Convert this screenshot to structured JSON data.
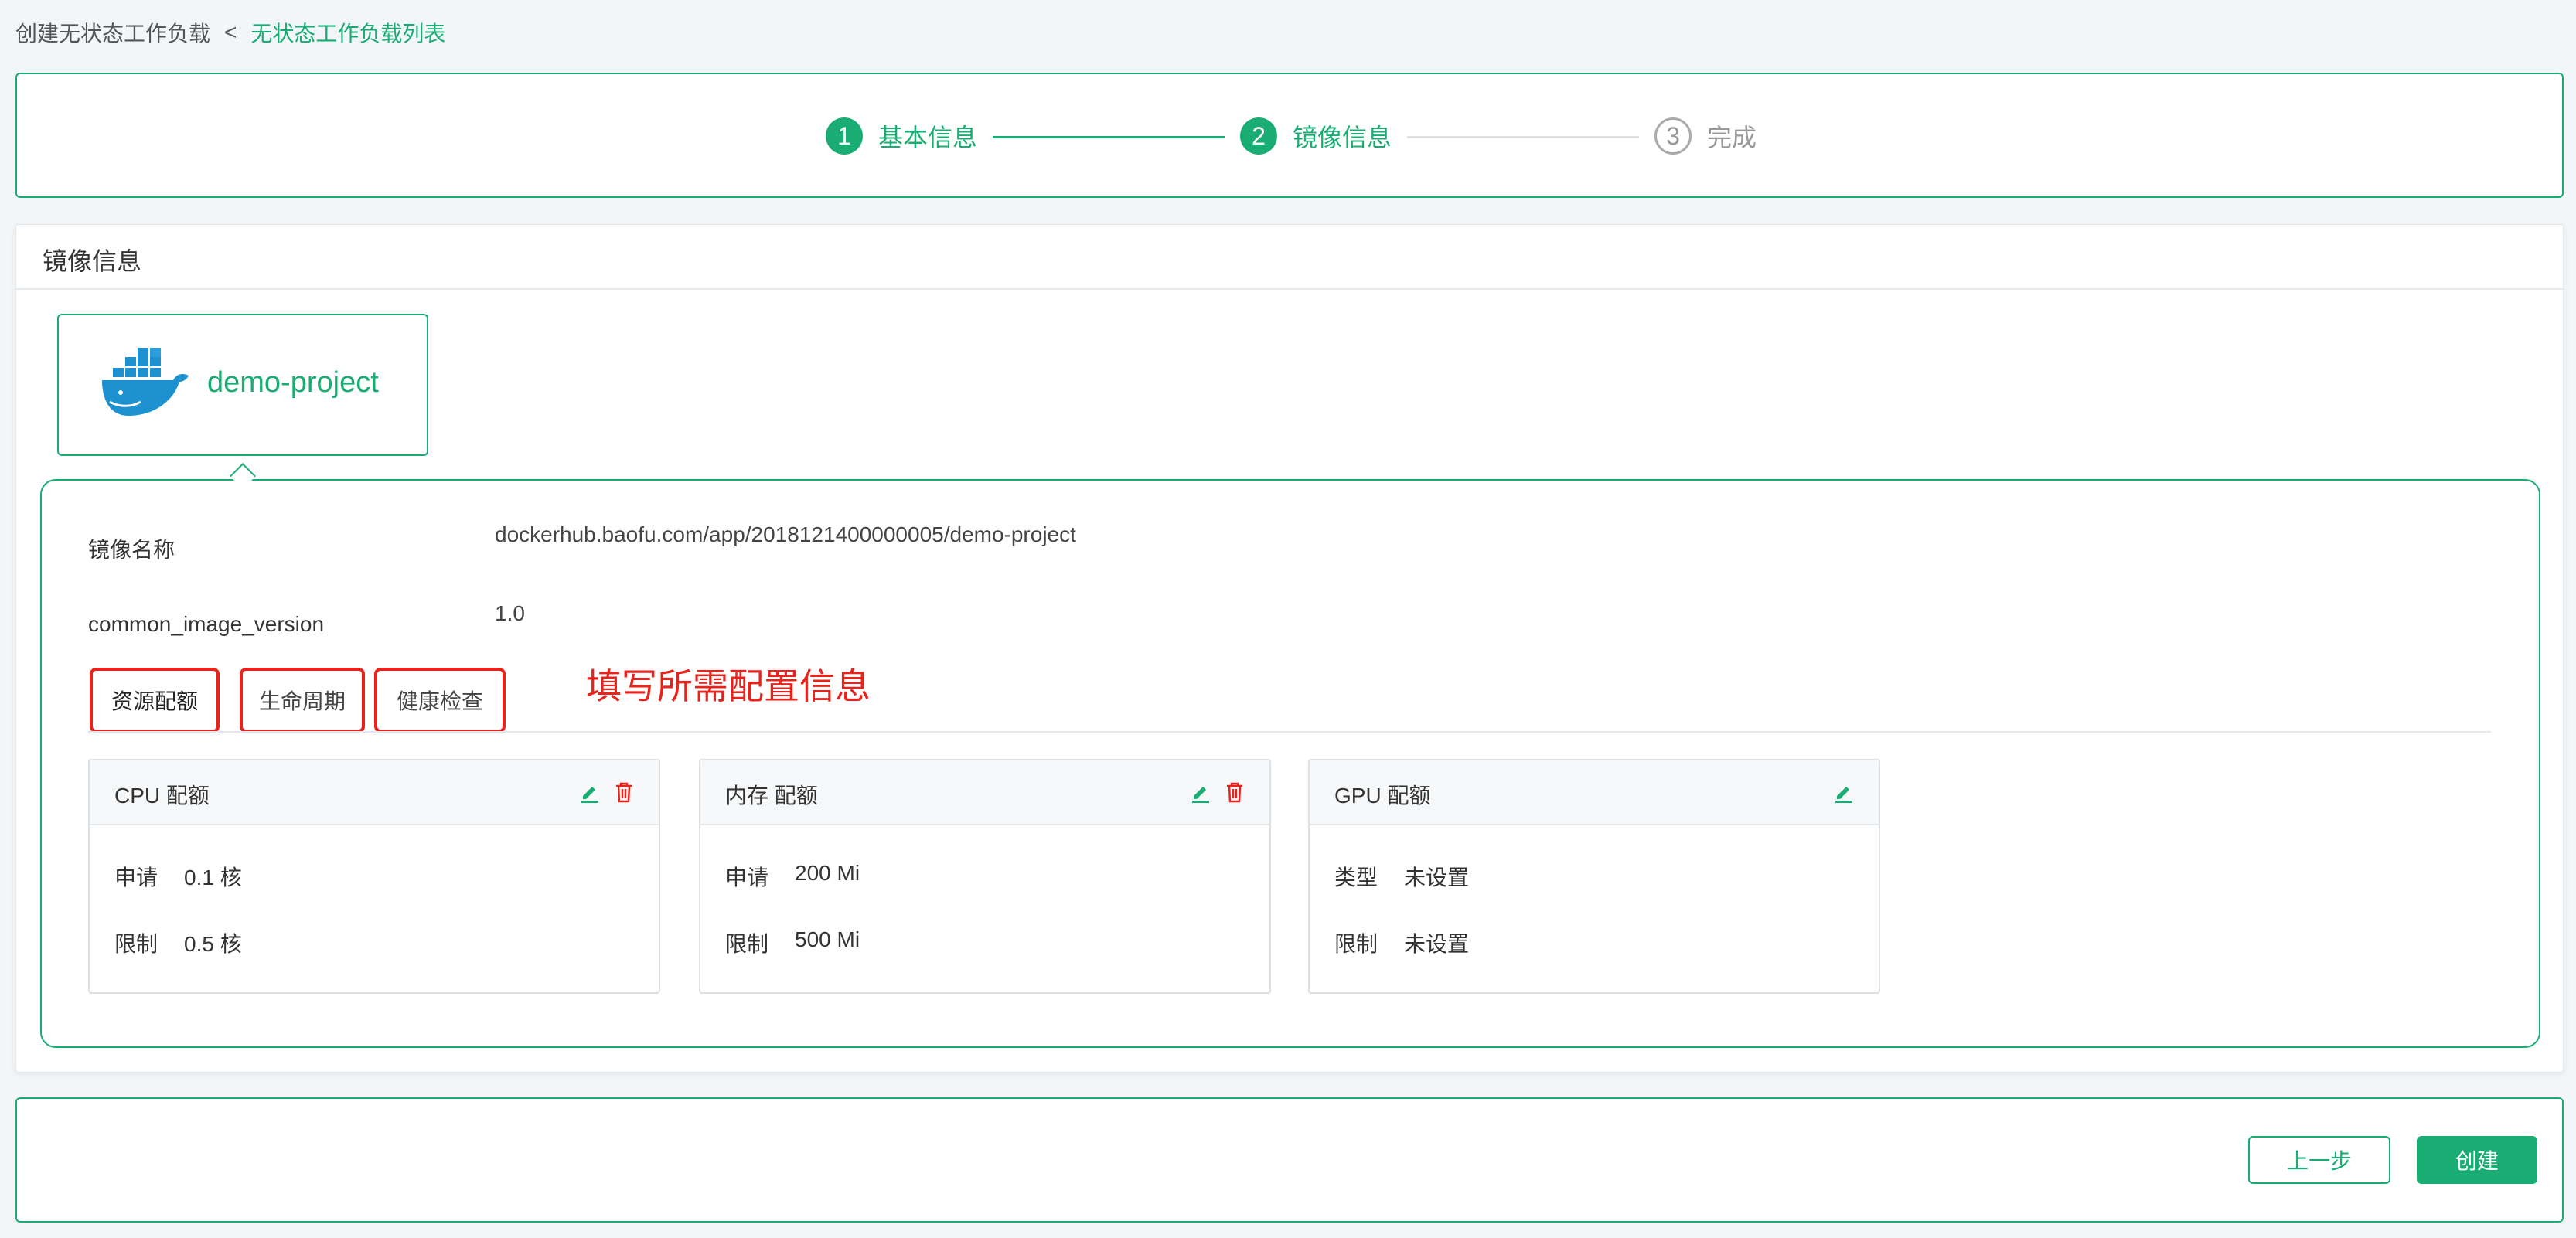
{
  "breadcrumb": {
    "current": "创建无状态工作负载",
    "separator": "<",
    "parent": "无状态工作负载列表"
  },
  "steps": [
    {
      "num": "1",
      "label": "基本信息",
      "state": "done"
    },
    {
      "num": "2",
      "label": "镜像信息",
      "state": "done"
    },
    {
      "num": "3",
      "label": "完成",
      "state": "todo"
    }
  ],
  "panel": {
    "title": "镜像信息"
  },
  "image": {
    "name": "demo-project",
    "icon": "docker-whale-icon"
  },
  "details": [
    {
      "label": "镜像名称",
      "value": "dockerhub.baofu.com/app/2018121400000005/demo-project"
    },
    {
      "label": "common_image_version",
      "value": "1.0"
    }
  ],
  "tabs": [
    {
      "label": "资源配额",
      "active": true
    },
    {
      "label": "生命周期",
      "active": false
    },
    {
      "label": "健康检查",
      "active": false
    }
  ],
  "annotation": "填写所需配置信息",
  "resources": [
    {
      "title": "CPU 配额",
      "editable": true,
      "deletable": true,
      "rows": [
        {
          "label": "申请",
          "value": "0.1 核"
        },
        {
          "label": "限制",
          "value": "0.5 核"
        }
      ]
    },
    {
      "title": "内存 配额",
      "editable": true,
      "deletable": true,
      "rows": [
        {
          "label": "申请",
          "value": "200 Mi"
        },
        {
          "label": "限制",
          "value": "500 Mi"
        }
      ]
    },
    {
      "title": "GPU 配额",
      "editable": true,
      "deletable": false,
      "rows": [
        {
          "label": "类型",
          "value": "未设置"
        },
        {
          "label": "限制",
          "value": "未设置"
        }
      ]
    }
  ],
  "footer": {
    "prev_label": "上一步",
    "create_label": "创建"
  },
  "colors": {
    "accent": "#1aad73",
    "annotation": "#e8231c",
    "danger": "#e8231c"
  }
}
